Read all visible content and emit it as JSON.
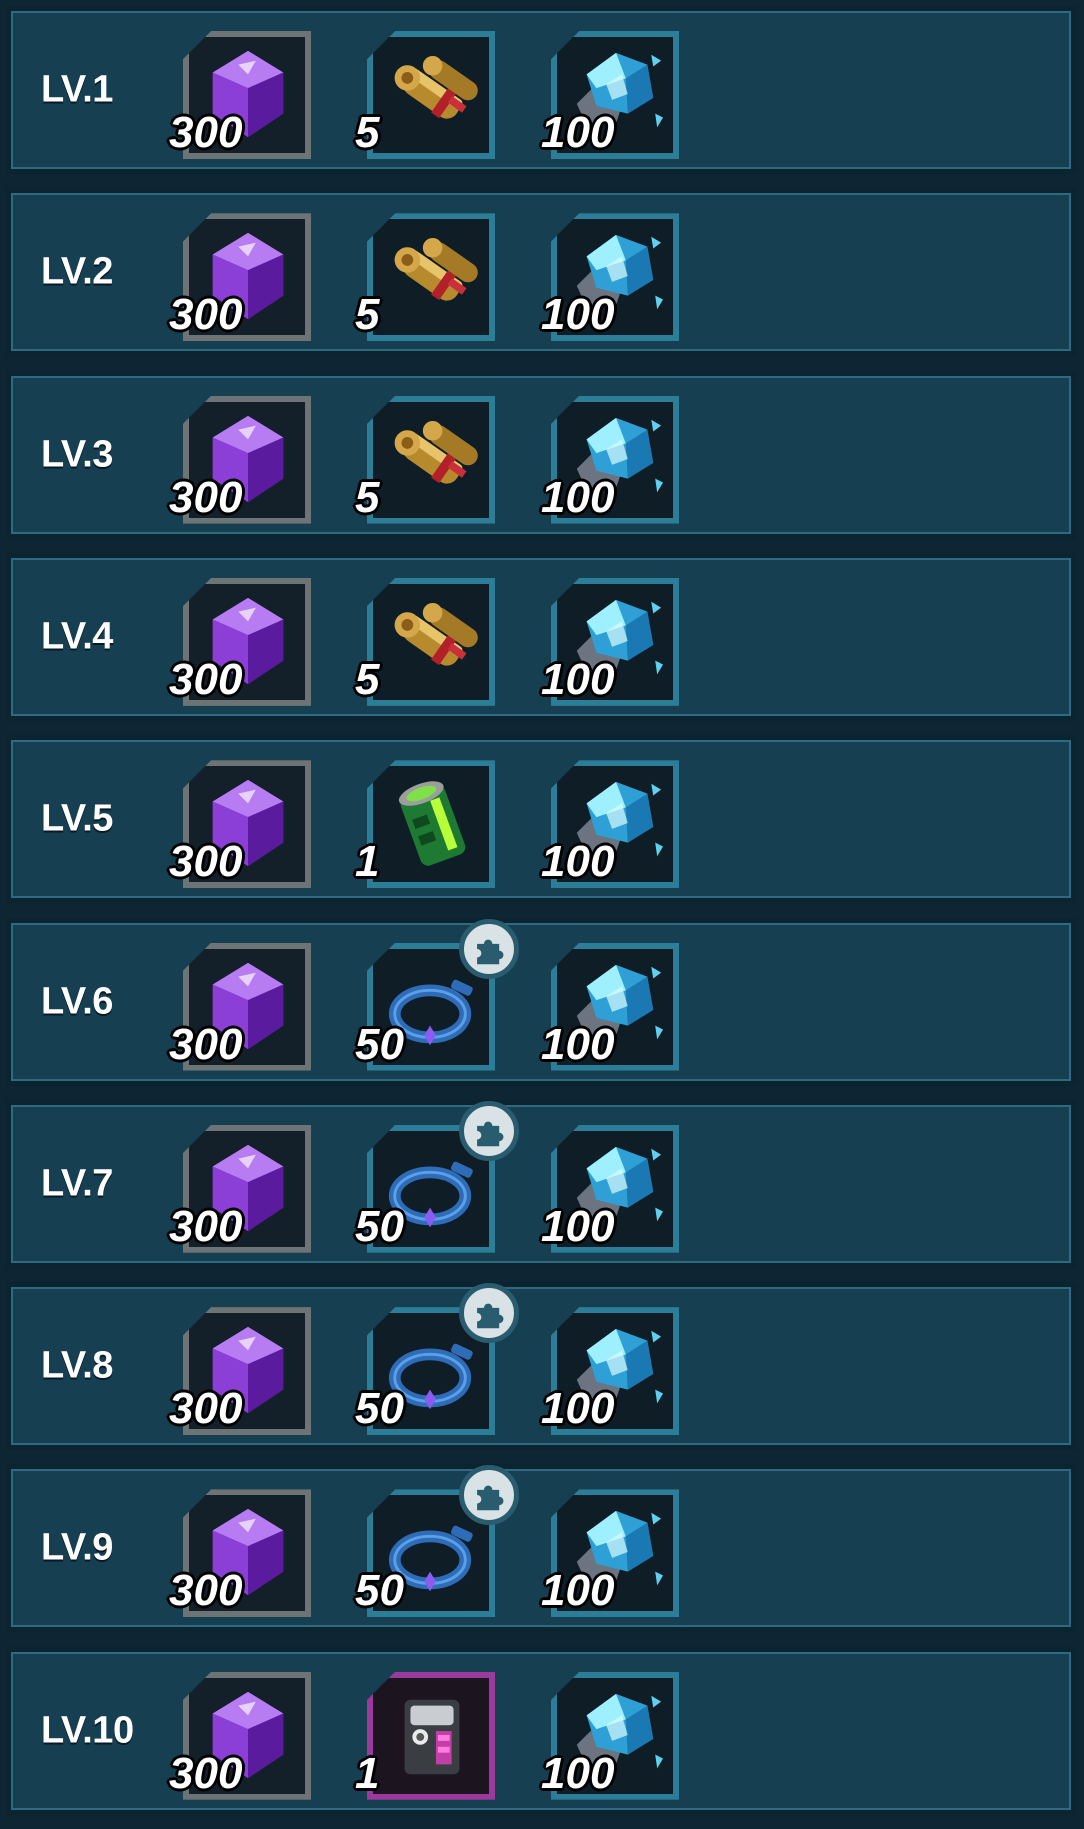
{
  "rows": [
    {
      "level": "LV.1",
      "rewards": [
        {
          "icon": "purple-gem-icon",
          "qty": "300"
        },
        {
          "icon": "scroll-icon",
          "qty": "5"
        },
        {
          "icon": "blue-crystal-ore-icon",
          "qty": "100"
        }
      ]
    },
    {
      "level": "LV.2",
      "rewards": [
        {
          "icon": "purple-gem-icon",
          "qty": "300"
        },
        {
          "icon": "scroll-icon",
          "qty": "5"
        },
        {
          "icon": "blue-crystal-ore-icon",
          "qty": "100"
        }
      ]
    },
    {
      "level": "LV.3",
      "rewards": [
        {
          "icon": "purple-gem-icon",
          "qty": "300"
        },
        {
          "icon": "scroll-icon",
          "qty": "5"
        },
        {
          "icon": "blue-crystal-ore-icon",
          "qty": "100"
        }
      ]
    },
    {
      "level": "LV.4",
      "rewards": [
        {
          "icon": "purple-gem-icon",
          "qty": "300"
        },
        {
          "icon": "scroll-icon",
          "qty": "5"
        },
        {
          "icon": "blue-crystal-ore-icon",
          "qty": "100"
        }
      ]
    },
    {
      "level": "LV.5",
      "rewards": [
        {
          "icon": "purple-gem-icon",
          "qty": "300"
        },
        {
          "icon": "green-canister-icon",
          "qty": "1"
        },
        {
          "icon": "blue-crystal-ore-icon",
          "qty": "100"
        }
      ]
    },
    {
      "level": "LV.6",
      "rewards": [
        {
          "icon": "purple-gem-icon",
          "qty": "300"
        },
        {
          "icon": "collar-fragment-icon",
          "qty": "50"
        },
        {
          "icon": "blue-crystal-ore-icon",
          "qty": "100"
        }
      ]
    },
    {
      "level": "LV.7",
      "rewards": [
        {
          "icon": "purple-gem-icon",
          "qty": "300"
        },
        {
          "icon": "collar-fragment-icon",
          "qty": "50"
        },
        {
          "icon": "blue-crystal-ore-icon",
          "qty": "100"
        }
      ]
    },
    {
      "level": "LV.8",
      "rewards": [
        {
          "icon": "purple-gem-icon",
          "qty": "300"
        },
        {
          "icon": "collar-fragment-icon",
          "qty": "50"
        },
        {
          "icon": "blue-crystal-ore-icon",
          "qty": "100"
        }
      ]
    },
    {
      "level": "LV.9",
      "rewards": [
        {
          "icon": "purple-gem-icon",
          "qty": "300"
        },
        {
          "icon": "collar-fragment-icon",
          "qty": "50"
        },
        {
          "icon": "blue-crystal-ore-icon",
          "qty": "100"
        }
      ]
    },
    {
      "level": "LV.10",
      "rewards": [
        {
          "icon": "purple-gem-icon",
          "qty": "300"
        },
        {
          "icon": "gear-backpack-icon",
          "qty": "1"
        },
        {
          "icon": "blue-crystal-ore-icon",
          "qty": "100"
        }
      ]
    }
  ],
  "colors": {
    "row_bg": "#163f52",
    "row_border": "#0c2430",
    "slot_gray": "#6c7476",
    "slot_teal": "#2c7d97",
    "slot_purple": "#9b3a9d",
    "gem": "#8b3fd6",
    "crystal": "#5fd0f0"
  },
  "fragment_badge_icon": "puzzle-piece-icon"
}
